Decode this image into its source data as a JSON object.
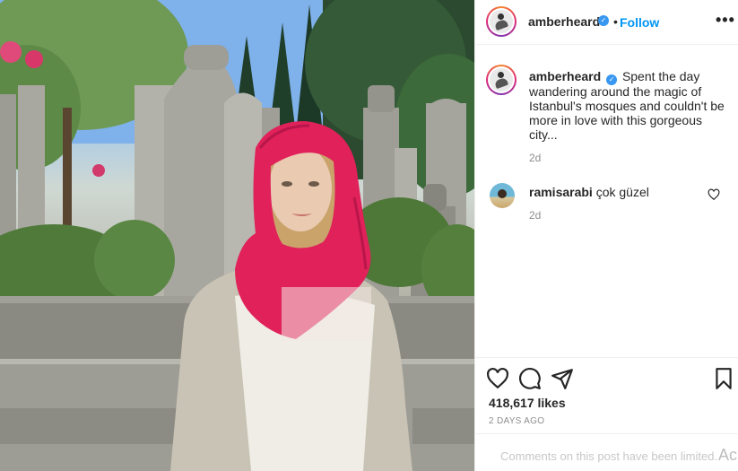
{
  "post": {
    "author": "amberheard",
    "follow_label": "Follow",
    "follow_separator": "•",
    "more_label": "•••"
  },
  "caption": {
    "author": "amberheard",
    "text": "Spent the day wandering around the magic of Istanbul's mosques and couldn't be more in love with this gorgeous city...",
    "time": "2d"
  },
  "comments": [
    {
      "author": "ramisarabi",
      "text": "çok güzel",
      "time": "2d"
    }
  ],
  "stats": {
    "likes": "418,617 likes",
    "posted_ago": "2 DAYS AGO"
  },
  "footer": {
    "limited_notice": "Comments on this post have been limited.",
    "watermark": "Ac"
  },
  "icons": {
    "verified": "verified-badge-icon",
    "like": "heart-icon",
    "comment": "speech-bubble-icon",
    "share": "paper-plane-icon",
    "save": "bookmark-icon",
    "more": "more-options-icon"
  },
  "colors": {
    "accent": "#0095f6",
    "verified": "#3897f0",
    "text": "#262626",
    "muted": "#8e8e8e",
    "border": "#efefef",
    "scarf": "#e0215a"
  }
}
